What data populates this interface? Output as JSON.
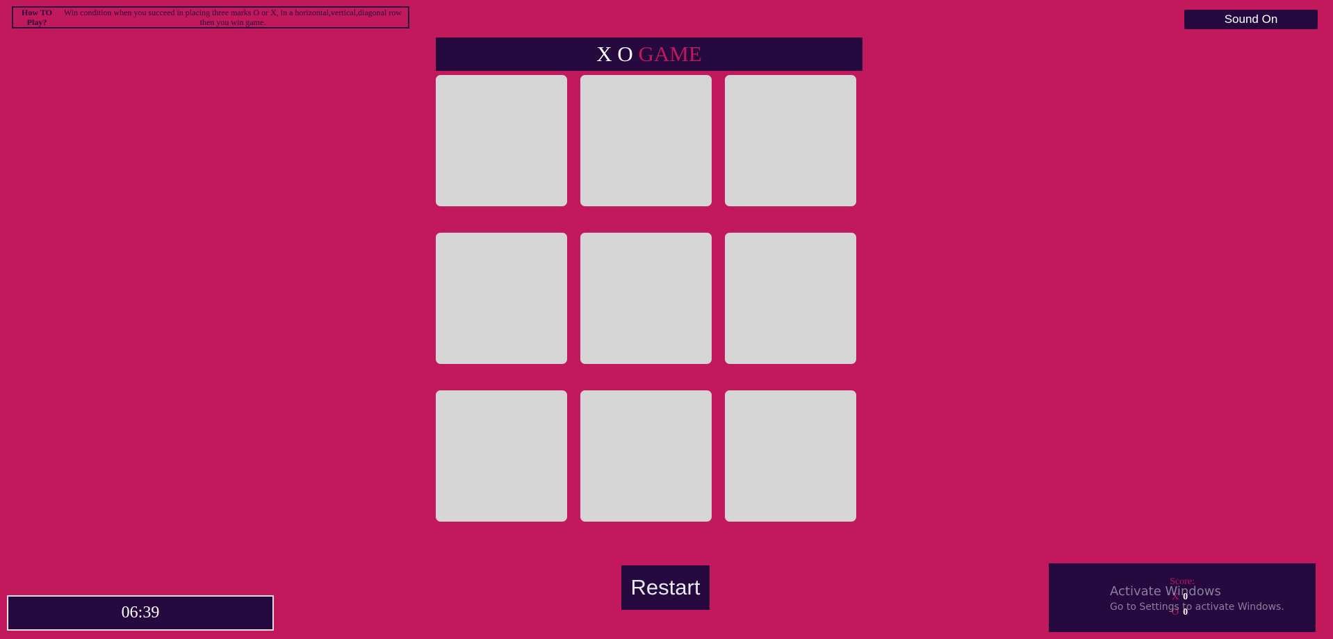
{
  "how_to_play": {
    "title": "How TO Play?",
    "text": "Win condition when you succeed in placing three marks O or X, in a horizontal,vertical,diagonal row then you win game."
  },
  "sound_button": "Sound On",
  "header": {
    "title_xo": "X O",
    "title_game": "GAME"
  },
  "board": {
    "cells": [
      "",
      "",
      "",
      "",
      "",
      "",
      "",
      "",
      ""
    ]
  },
  "restart_button": "Restart",
  "timer": "06:39",
  "score": {
    "label": "Score:",
    "x_label": "X",
    "x_value": "0",
    "o_label": "O",
    "o_value": "0"
  },
  "os_watermark": {
    "title": "Activate Windows",
    "subtitle": "Go to Settings to activate Windows."
  },
  "colors": {
    "background": "#c2195c",
    "panel": "#25093f",
    "cell": "#d6d6d6",
    "accent": "#c2195c"
  }
}
